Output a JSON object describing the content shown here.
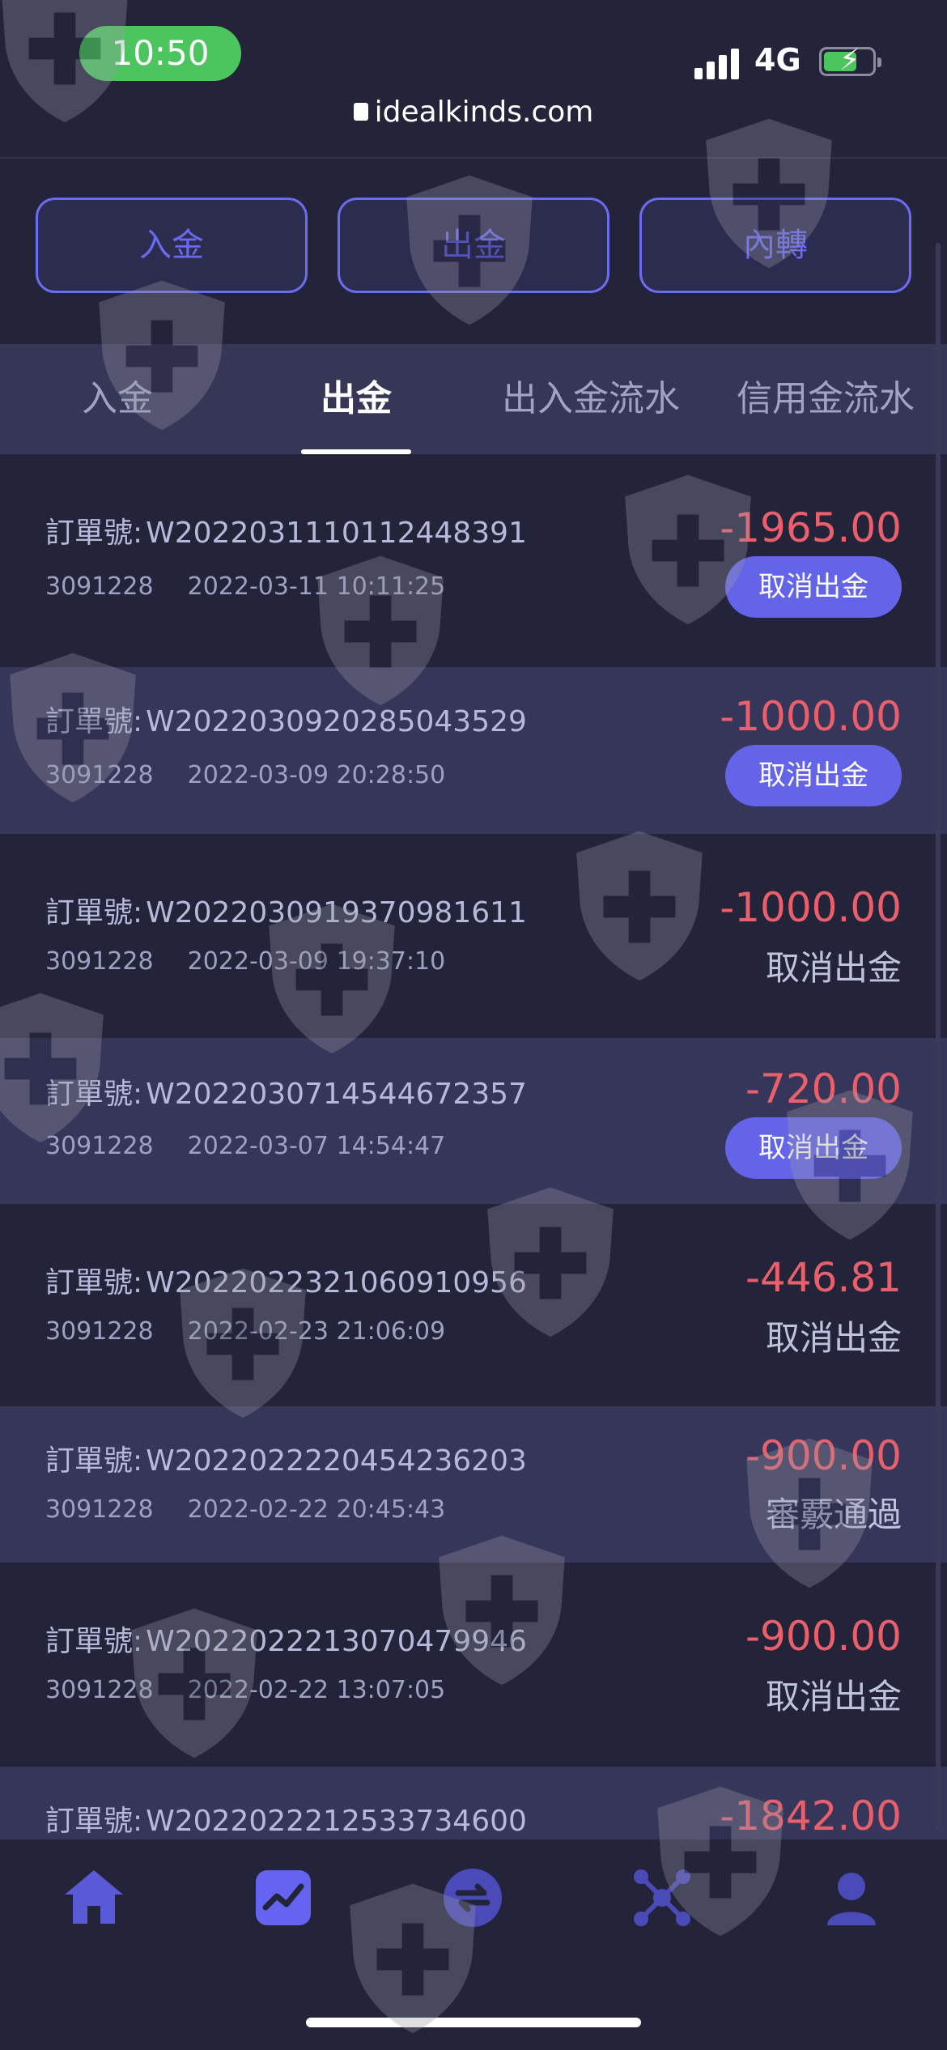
{
  "status_bar": {
    "time": "10:50",
    "network": "4G"
  },
  "browser": {
    "url": "idealkinds.com"
  },
  "actions": [
    "入金",
    "出金",
    "內轉"
  ],
  "tabs": [
    "入金",
    "出金",
    "出入金流水",
    "信用金流水"
  ],
  "active_tab": "出金",
  "order_label": "訂單號:",
  "records": [
    {
      "order_no": "W2022031110112448391",
      "uid": "3091228",
      "datetime": "2022-03-11 10:11:25",
      "amount": "-1965.00",
      "status": "取消出金",
      "status_is_button": true
    },
    {
      "order_no": "W2022030920285043529",
      "uid": "3091228",
      "datetime": "2022-03-09 20:28:50",
      "amount": "-1000.00",
      "status": "取消出金",
      "status_is_button": true
    },
    {
      "order_no": "W2022030919370981611",
      "uid": "3091228",
      "datetime": "2022-03-09 19:37:10",
      "amount": "-1000.00",
      "status": "取消出金",
      "status_is_button": false
    },
    {
      "order_no": "W2022030714544672357",
      "uid": "3091228",
      "datetime": "2022-03-07 14:54:47",
      "amount": "-720.00",
      "status": "取消出金",
      "status_is_button": true
    },
    {
      "order_no": "W2022022321060910956",
      "uid": "3091228",
      "datetime": "2022-02-23 21:06:09",
      "amount": "-446.81",
      "status": "取消出金",
      "status_is_button": false
    },
    {
      "order_no": "W2022022220454236203",
      "uid": "3091228",
      "datetime": "2022-02-22 20:45:43",
      "amount": "-900.00",
      "status": "審覈通過",
      "status_is_button": false
    },
    {
      "order_no": "W2022022213070479946",
      "uid": "3091228",
      "datetime": "2022-02-22 13:07:05",
      "amount": "-900.00",
      "status": "取消出金",
      "status_is_button": false
    },
    {
      "order_no": "W2022022212533734600",
      "uid": "",
      "datetime": "",
      "amount": "-1842.00",
      "status": "",
      "status_is_button": false
    }
  ],
  "bottom_nav": [
    {
      "icon": "home-icon",
      "active": false
    },
    {
      "icon": "chart-icon",
      "active": true
    },
    {
      "icon": "exchange-icon",
      "active": false
    },
    {
      "icon": "network-icon",
      "active": false
    },
    {
      "icon": "user-icon",
      "active": false
    }
  ],
  "colors": {
    "accent": "#6464e8",
    "negative": "#e9606c",
    "background": "#23233a",
    "row_alt": "#36365a"
  }
}
